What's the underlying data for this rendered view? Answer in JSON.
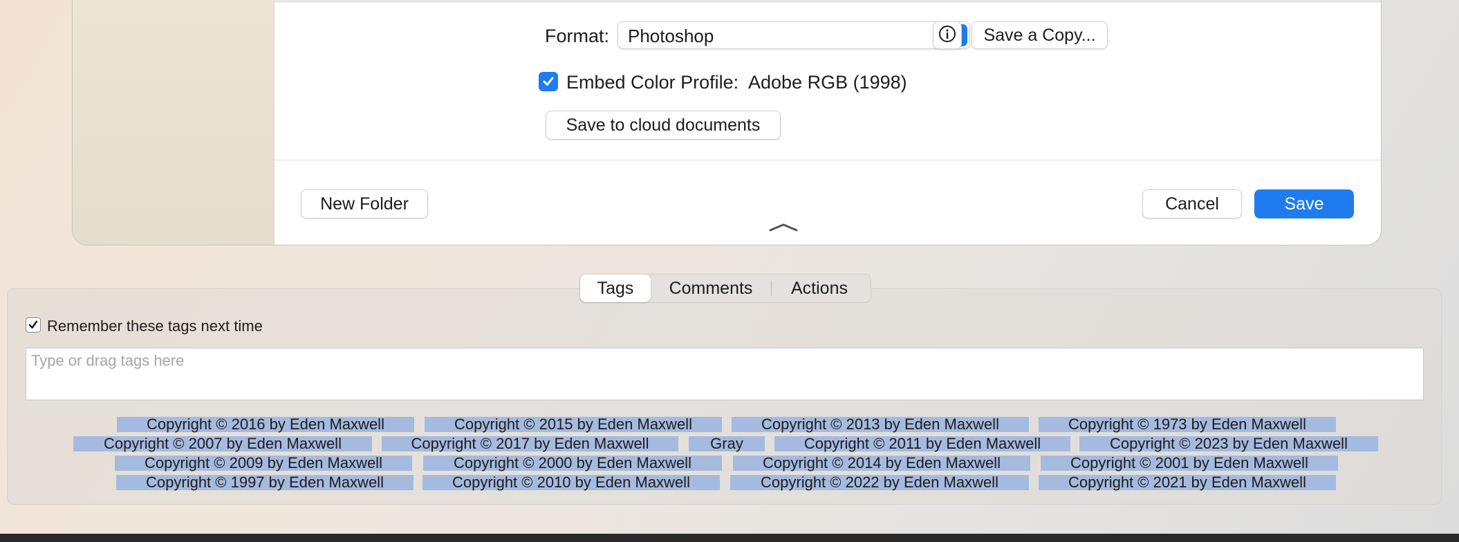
{
  "dialog": {
    "format_label": "Format:",
    "format_value": "Photoshop",
    "save_copy_label": "Save a Copy...",
    "embed_profile_label": "Embed Color Profile:",
    "embed_profile_value": "Adobe RGB (1998)",
    "embed_profile_checked": true,
    "cloud_button": "Save to cloud documents",
    "new_folder_button": "New Folder",
    "cancel_button": "Cancel",
    "save_button": "Save"
  },
  "tags_panel": {
    "tabs": [
      {
        "label": "Tags",
        "selected": true
      },
      {
        "label": "Comments",
        "selected": false
      },
      {
        "label": "Actions",
        "selected": false
      }
    ],
    "remember_label": "Remember these tags next time",
    "remember_checked": true,
    "input_placeholder": "Type or drag tags here",
    "tags": [
      "Copyright © 2016 by Eden Maxwell",
      "Copyright © 2015 by Eden Maxwell",
      "Copyright © 2013 by Eden Maxwell",
      "Copyright © 1973 by Eden Maxwell",
      "Copyright © 2007 by Eden Maxwell",
      "Copyright © 2017 by Eden Maxwell",
      "Gray",
      "Copyright © 2011 by Eden Maxwell",
      "Copyright © 2023 by Eden Maxwell",
      "Copyright © 2009 by Eden Maxwell",
      "Copyright © 2000 by Eden Maxwell",
      "Copyright © 2014 by Eden Maxwell",
      "Copyright © 2001 by Eden Maxwell",
      "Copyright © 1997 by Eden Maxwell",
      "Copyright © 2010 by Eden Maxwell",
      "Copyright © 2022 by Eden Maxwell",
      "Copyright © 2021 by Eden Maxwell"
    ]
  },
  "colors": {
    "accent": "#1f7bf0",
    "tag_background": "#a5badf"
  }
}
